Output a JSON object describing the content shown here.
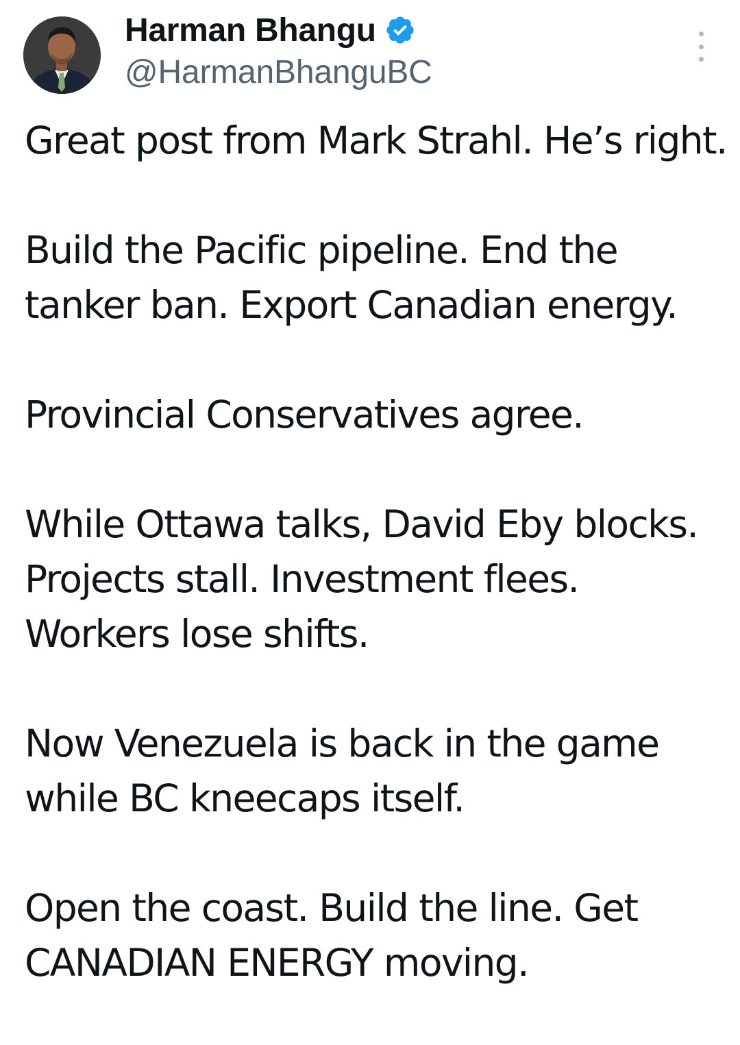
{
  "author": {
    "display_name": "Harman Bhangu",
    "handle": "@HarmanBhanguBC",
    "verified": true,
    "avatar_icon": "profile-photo",
    "verified_icon": "verified-badge-icon",
    "verified_color": "#1d9bf0"
  },
  "menu": {
    "icon": "more-vertical-icon"
  },
  "tweet": {
    "paragraphs": [
      "Great post from Mark Strahl. He’s right.",
      "Build the Pacific pipeline. End the tanker ban. Export Canadian energy.",
      "Provincial Conservatives agree.",
      "While Ottawa talks, David Eby blocks. Projects stall. Investment flees. Workers lose shifts.",
      "Now Venezuela is back in the game while BC kneecaps itself.",
      "Open the coast. Build the line. Get CANADIAN ENERGY moving."
    ]
  },
  "colors": {
    "text": "#0f1419",
    "secondary": "#536471",
    "background": "#ffffff"
  }
}
